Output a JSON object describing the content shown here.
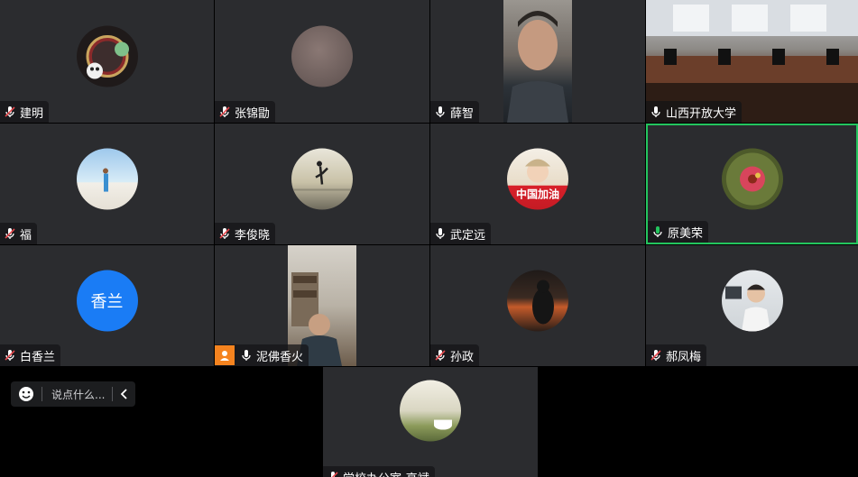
{
  "participants": [
    {
      "name": "建明",
      "mic": "muted"
    },
    {
      "name": "张锦勖",
      "mic": "muted"
    },
    {
      "name": "薛智",
      "mic": "on"
    },
    {
      "name": "山西开放大学",
      "mic": "on"
    },
    {
      "name": "福",
      "mic": "muted"
    },
    {
      "name": "李俊晓",
      "mic": "muted"
    },
    {
      "name": "武定远",
      "mic": "on"
    },
    {
      "name": "原美荣",
      "mic": "speaking"
    },
    {
      "name": "白香兰",
      "mic": "muted",
      "avatar_text": "香兰"
    },
    {
      "name": "泥佛香火",
      "mic": "on"
    },
    {
      "name": "孙政",
      "mic": "muted"
    },
    {
      "name": "郝凤梅",
      "mic": "muted"
    },
    {
      "name": "学校办公室-高斌",
      "mic": "muted"
    }
  ],
  "avatar_banner_text": "中国加油",
  "chat": {
    "placeholder": "说点什么..."
  },
  "colors": {
    "speaking": "#23c55e",
    "tile_bg": "#2b2c2f",
    "avatar_blue": "#1a7cf5",
    "camera_badge": "#f5831f"
  }
}
